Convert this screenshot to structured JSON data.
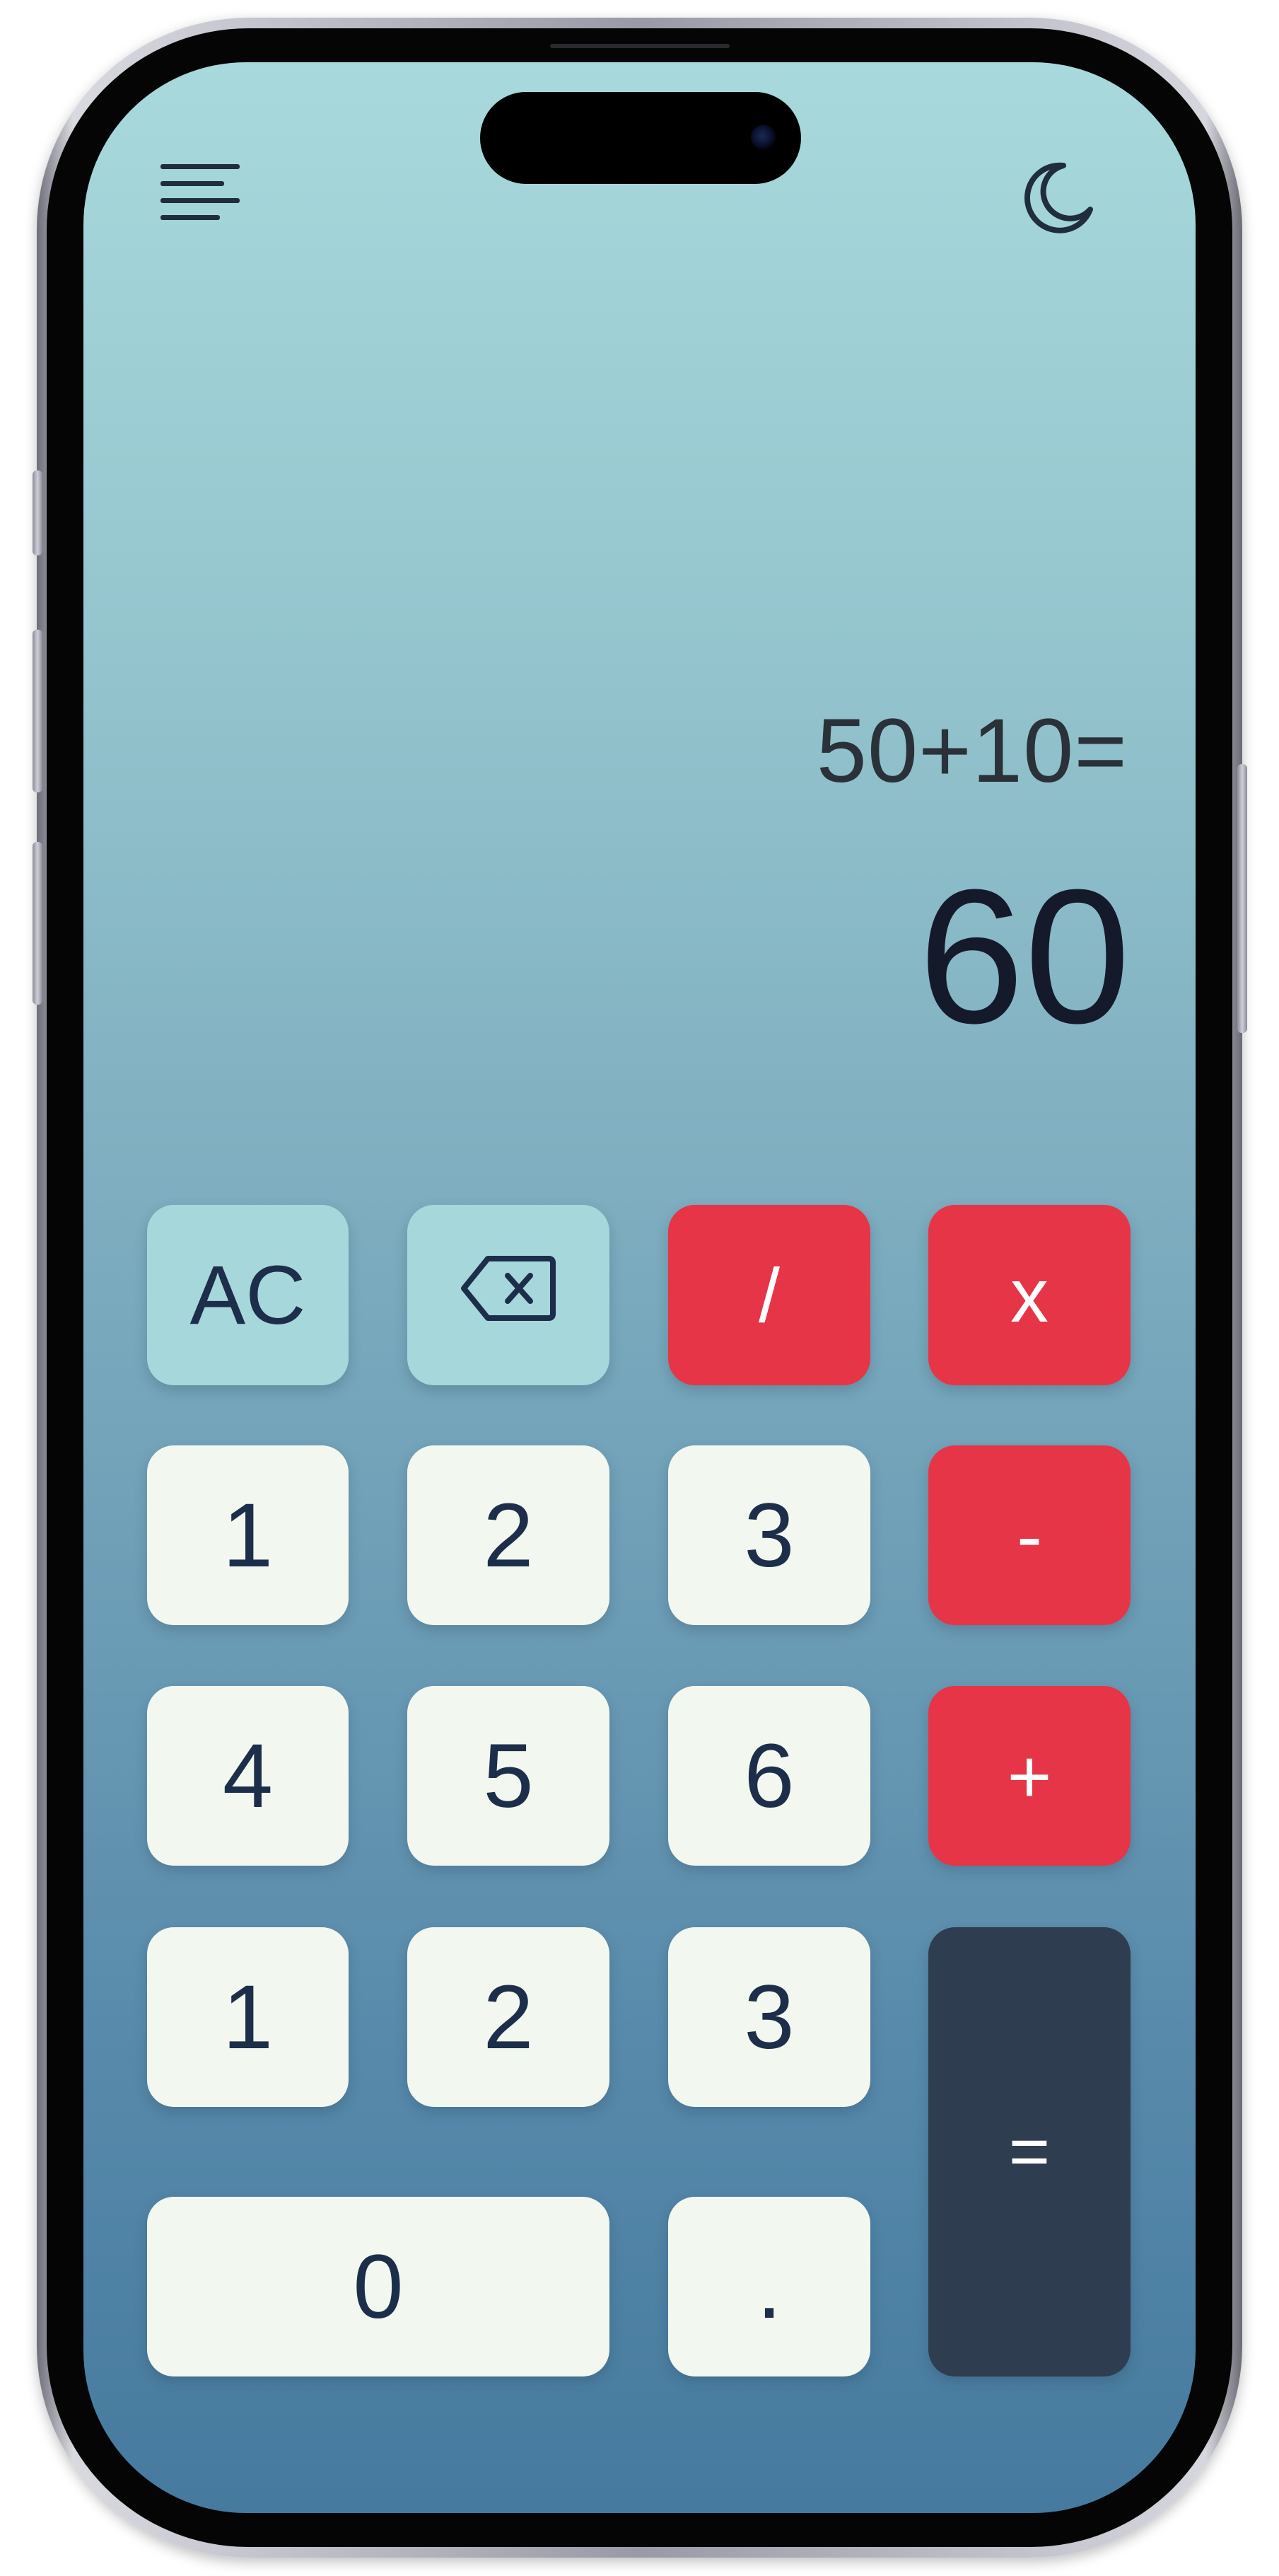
{
  "header": {
    "menu_icon": "menu-lines-icon",
    "theme_icon": "moon-icon"
  },
  "display": {
    "expression": "50+10=",
    "result": "60"
  },
  "keypad": {
    "clear": "AC",
    "backspace_icon": "backspace-icon",
    "divide": "/",
    "multiply": "x",
    "minus": "-",
    "plus": "+",
    "equals": "=",
    "decimal": ".",
    "zero": "0",
    "row1": [
      "1",
      "2",
      "3"
    ],
    "row2": [
      "4",
      "5",
      "6"
    ],
    "row3": [
      "1",
      "2",
      "3"
    ]
  },
  "colors": {
    "operator_red": "#e63546",
    "digit_key": "#f2f8ef",
    "function_key": "#a6d7db",
    "equals_key": "#2e3e50",
    "text_dark": "#1c2e4a"
  }
}
